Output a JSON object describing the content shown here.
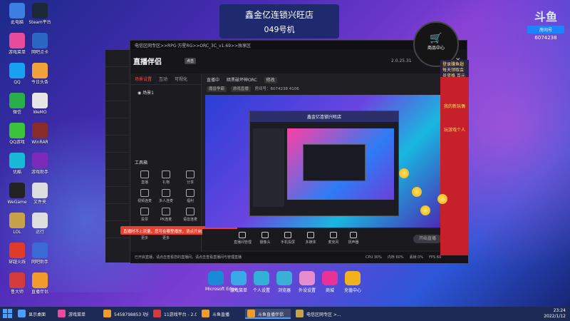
{
  "overlay": {
    "shop_title": "鑫金亿连锁兴旺店",
    "shop_sub": "049号机",
    "douyu_logo": "斗鱼",
    "room_label": "房间号",
    "room_number": "6074238",
    "cart_label": "商品中心",
    "promo_text": "登录赚鱼翅 每天领取会员资格 百元现金",
    "side_button_1": "我的新玩偶",
    "side_button_2": "玩游戏个人"
  },
  "desktop_icons": [
    {
      "label": "此电脑",
      "color": "#3c7fe0"
    },
    {
      "label": "Steam平台",
      "color": "#1b2838"
    },
    {
      "label": "游戏菜单",
      "color": "#e84b9b"
    },
    {
      "label": "网吧点卡",
      "color": "#2b66c2"
    },
    {
      "label": "QQ",
      "color": "#1aa0f0"
    },
    {
      "label": "今日头条",
      "color": "#f2a23a"
    },
    {
      "label": "微信",
      "color": "#2aae4a"
    },
    {
      "label": "WeMO",
      "color": "#e6e6e6"
    },
    {
      "label": "QQ游戏",
      "color": "#3cc33c"
    },
    {
      "label": "WinRAR",
      "color": "#8a2b2b"
    },
    {
      "label": "优酷",
      "color": "#17b9d6"
    },
    {
      "label": "游戏助手",
      "color": "#7a2bb8"
    },
    {
      "label": "WeGame",
      "color": "#222"
    },
    {
      "label": "文件夹",
      "color": "#ddd"
    },
    {
      "label": "LOL",
      "color": "#c8a24a"
    },
    {
      "label": "运行",
      "color": "#ddd"
    },
    {
      "label": "穿越火线",
      "color": "#e03b2a"
    },
    {
      "label": "网吧助手",
      "color": "#3b6ad6"
    },
    {
      "label": "鲁大师",
      "color": "#d63b3b"
    },
    {
      "label": "直播伴侣",
      "color": "#f29b2a"
    }
  ],
  "app": {
    "title_bar": "电信区网专区>>RPG·万星RG>>ORC_3C_v1.69>>独享区",
    "logo": "直播伴侣",
    "logo_tag": "点击",
    "version": "2.0.25.31",
    "tabs": [
      "场景设置",
      "互动",
      "可视化"
    ],
    "scene_item": "场景1",
    "tools_title": "工具箱",
    "tools": [
      "直播",
      "礼物",
      "分享",
      "视频连麦",
      "多人连麦",
      "福利",
      "投票",
      "PK连麦",
      "语音连麦",
      "更多",
      "更多"
    ],
    "red_tip": "直播时不上流量，您可在哪里播放，请点开启开启你的直播",
    "live_status": "直播中",
    "live_title": "暗黑破坏神ORC",
    "live_title_tag": "修改",
    "category_tag": "魔兽争霸",
    "category_tag2": "游戏直播",
    "room_info": "房间号：6074238",
    "fans": "4106",
    "inner_window_title": "鑫金亿连锁兴旺店",
    "toolbar": [
      "直播间管理",
      "摄像头",
      "手机投屏",
      "多媒体",
      "麦克风",
      "扬声器"
    ],
    "go_live_button": "开始直播",
    "status_text": "已开启直播，请点击查看您的直播间，请点击查看直播间与管理直播",
    "stats": [
      "CPU 30%",
      "内存 60%",
      "丢帧 0%",
      "FPS 60"
    ]
  },
  "dock": [
    {
      "label": "Microsoft Edge",
      "color": "#1b8ad6"
    },
    {
      "label": "游戏菜单",
      "color": "#3aa9e6"
    },
    {
      "label": "个人设置",
      "color": "#33b0d6"
    },
    {
      "label": "浏览器",
      "color": "#3ab0d6"
    },
    {
      "label": "外设设置",
      "color": "#e88cd0"
    },
    {
      "label": "商城",
      "color": "#e8329a"
    },
    {
      "label": "充值中心",
      "color": "#f2b11e"
    }
  ],
  "taskbar": {
    "items": [
      {
        "label": "显示桌面",
        "color": "#4aa0ff",
        "active": false
      },
      {
        "label": "游戏菜单",
        "color": "#e84b9b",
        "active": false
      },
      {
        "label": "5458798853 功能...",
        "color": "#f29b2a",
        "active": false
      },
      {
        "label": "11游戏平台 - 2.0.2...",
        "color": "#d63b3b",
        "active": false
      },
      {
        "label": "斗鱼直播",
        "color": "#f29b2a",
        "active": false
      },
      {
        "label": "斗鱼直播伴侣",
        "color": "#f29b2a",
        "active": true
      },
      {
        "label": "电信区网专区 >...",
        "color": "#c8a24a",
        "active": false
      }
    ],
    "time": "23:24",
    "date": "2022/1/12"
  }
}
